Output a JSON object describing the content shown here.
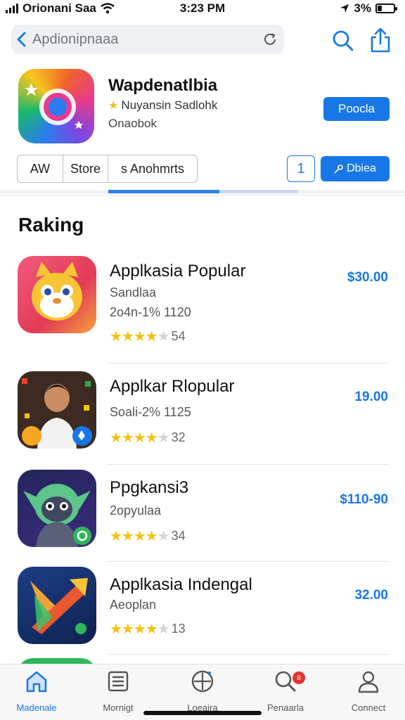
{
  "status_bar": {
    "carrier": "Orionani Saa",
    "time": "3:23 PM",
    "battery": "3%"
  },
  "search": {
    "text": "Apdionipnaaa"
  },
  "hero": {
    "title": "Wapdenatlbia",
    "subtitle": "Nuyansin Sadlohk",
    "subtitle2": "Onaobok",
    "primary_button": "Poocla"
  },
  "tabs": [
    "AW",
    "Store",
    "s Anohmrts"
  ],
  "num_box": "1",
  "secondary_button": "Dbiea",
  "section_title": "Raking",
  "apps": [
    {
      "name": "Applkasia Popular",
      "line2": "Sandlaa",
      "line3": "2o4n-1%  1120",
      "rating_count": "54",
      "stars": 4,
      "price": "$30.00"
    },
    {
      "name": "Applkar Rlopular",
      "line2": "Soali-2%  1125",
      "line3": "",
      "rating_count": "32",
      "stars": 4,
      "price": "19.00"
    },
    {
      "name": "Ppgkansi3",
      "line2": "2opyulaa",
      "line3": "",
      "rating_count": "34",
      "stars": 4,
      "price": "$110-90"
    },
    {
      "name": "Applkasia Indengal",
      "line2": "Aeoplan",
      "line3": "",
      "rating_count": "13",
      "stars": 4,
      "price": "32.00"
    }
  ],
  "nav": [
    {
      "label": "Madenale",
      "icon": "home-icon"
    },
    {
      "label": "Mornigt",
      "icon": "news-icon"
    },
    {
      "label": "Loeaira",
      "icon": "compass-icon"
    },
    {
      "label": "Penaarla",
      "icon": "search-icon",
      "badge": "8"
    },
    {
      "label": "Connect",
      "icon": "profile-icon"
    }
  ],
  "colors": {
    "accent": "#1877e6",
    "star": "#f4c20d",
    "badge": "#e8322c"
  }
}
